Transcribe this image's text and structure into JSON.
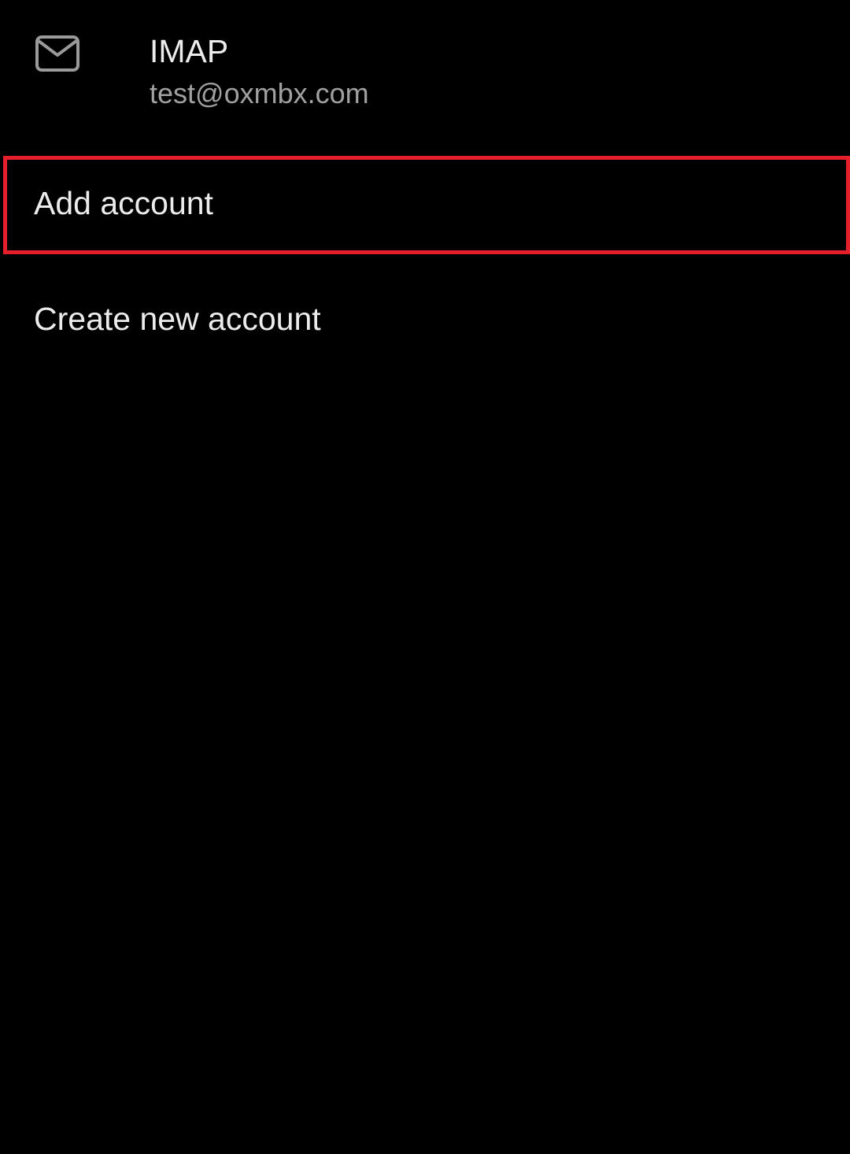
{
  "account": {
    "icon": "mail-icon",
    "type": "IMAP",
    "email": "test@oxmbx.com"
  },
  "menu": {
    "add_account_label": "Add account",
    "create_account_label": "Create new account"
  },
  "colors": {
    "background": "#000000",
    "primary_text": "#ececec",
    "secondary_text": "#a0a0a0",
    "highlight": "#e5202a"
  }
}
